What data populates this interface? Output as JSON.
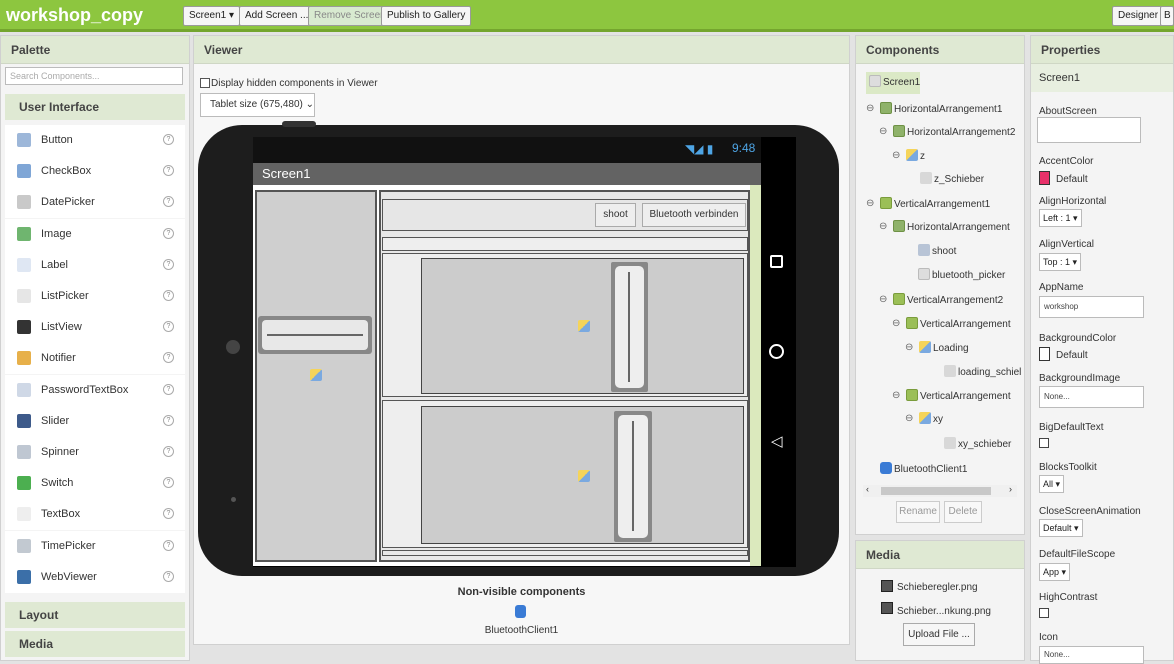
{
  "topbar": {
    "title": "workshop_copy",
    "screen_select": "Screen1 ▾",
    "add_screen": "Add Screen ...",
    "remove_screen": "Remove Screen",
    "publish": "Publish to Gallery",
    "designer": "Designer",
    "blocks_partial": "B"
  },
  "palette": {
    "title": "Palette",
    "search_placeholder": "Search Components...",
    "category_user_interface": "User Interface",
    "items": [
      {
        "label": "Button",
        "icon": "button-icon"
      },
      {
        "label": "CheckBox",
        "icon": "checkbox-icon"
      },
      {
        "label": "DatePicker",
        "icon": "datepicker-icon"
      },
      {
        "label": "Image",
        "icon": "image-icon"
      },
      {
        "label": "Label",
        "icon": "label-icon"
      },
      {
        "label": "ListPicker",
        "icon": "listpicker-icon"
      },
      {
        "label": "ListView",
        "icon": "listview-icon"
      },
      {
        "label": "Notifier",
        "icon": "notifier-icon"
      },
      {
        "label": "PasswordTextBox",
        "icon": "passwordtextbox-icon"
      },
      {
        "label": "Slider",
        "icon": "slider-icon"
      },
      {
        "label": "Spinner",
        "icon": "spinner-icon"
      },
      {
        "label": "Switch",
        "icon": "switch-icon"
      },
      {
        "label": "TextBox",
        "icon": "textbox-icon"
      },
      {
        "label": "TimePicker",
        "icon": "timepicker-icon"
      },
      {
        "label": "WebViewer",
        "icon": "webviewer-icon"
      }
    ],
    "help_glyph": "?",
    "category_layout": "Layout",
    "category_media": "Media"
  },
  "viewer": {
    "title": "Viewer",
    "hidden_checkbox_label": "Display hidden components in Viewer",
    "size_select": "Tablet size (675,480)",
    "status_time": "9:48",
    "screen_title": "Screen1",
    "shoot_button": "shoot",
    "bluetooth_button": "Bluetooth verbinden",
    "nonvisible_title": "Non-visible components",
    "nonvisible_item": "BluetoothClient1"
  },
  "components": {
    "title": "Components",
    "tree": [
      "Screen1",
      "HorizontalArrangement1",
      "HorizontalArrangement2",
      "z",
      "z_Schieber",
      "VerticalArrangement1",
      "HorizontalArrangement",
      "shoot",
      "bluetooth_picker",
      "VerticalArrangement2",
      "VerticalArrangement",
      "Loading",
      "loading_schiel",
      "VerticalArrangement",
      "xy",
      "xy_schieber",
      "BluetoothClient1"
    ],
    "collapse_glyph": "⊖",
    "rename": "Rename",
    "delete": "Delete"
  },
  "media": {
    "title": "Media",
    "files": [
      "Schieberegler.png",
      "Schieber...nkung.png"
    ],
    "upload": "Upload File ..."
  },
  "properties": {
    "title": "Properties",
    "component": "Screen1",
    "about_label": "AboutScreen",
    "accent_label": "AccentColor",
    "accent_value": "Default",
    "accent_color": "#e8316a",
    "align_h_label": "AlignHorizontal",
    "align_h_value": "Left : 1 ▾",
    "align_v_label": "AlignVertical",
    "align_v_value": "Top : 1 ▾",
    "appname_label": "AppName",
    "appname_value": "workshop",
    "bgcolor_label": "BackgroundColor",
    "bgcolor_value": "Default",
    "bgimage_label": "BackgroundImage",
    "bgimage_value": "None...",
    "bigtext_label": "BigDefaultText",
    "toolkit_label": "BlocksToolkit",
    "toolkit_value": "All ▾",
    "anim_label": "CloseScreenAnimation",
    "anim_value": "Default ▾",
    "filescope_label": "DefaultFileScope",
    "filescope_value": "App ▾",
    "contrast_label": "HighContrast",
    "icon_label": "Icon",
    "icon_value": "None..."
  },
  "colors": {
    "brand_green": "#8dc63f",
    "header_bg": "#dfe9d3",
    "phone_body": "#222222",
    "selected": "#dbe9c6"
  }
}
